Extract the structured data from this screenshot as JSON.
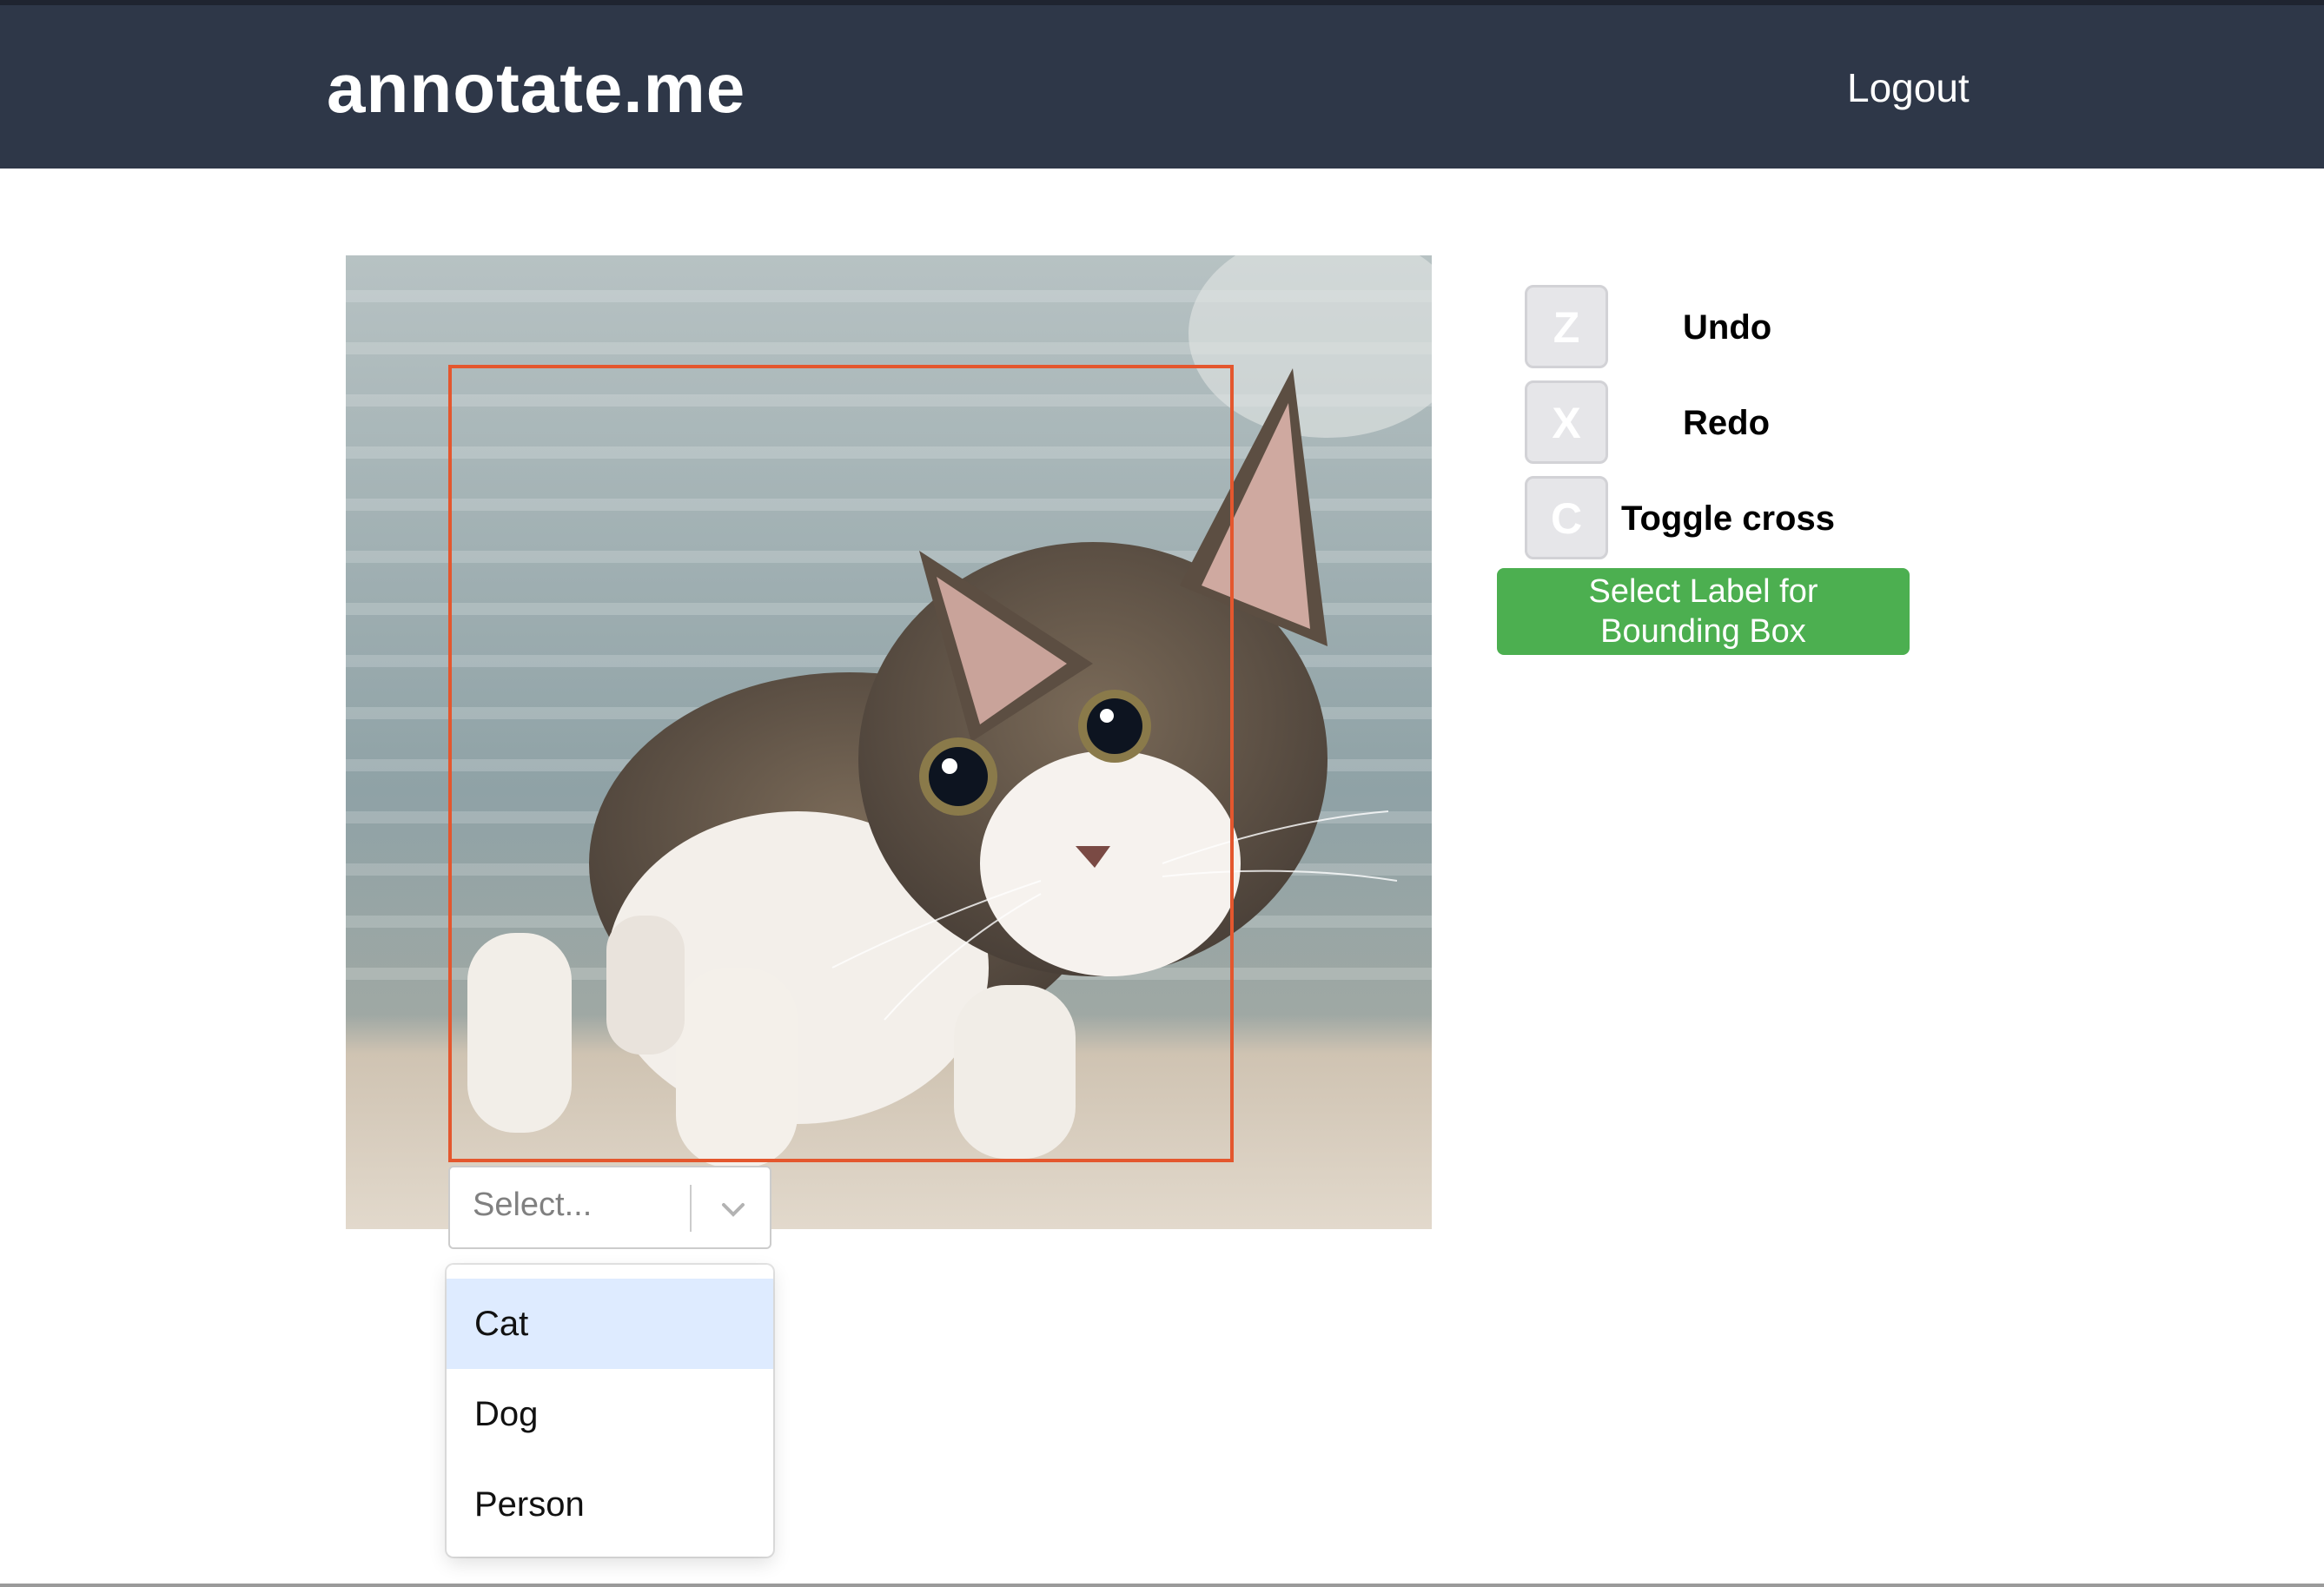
{
  "header": {
    "brand": "annotate.me",
    "logout_label": "Logout",
    "background": "#2e3748"
  },
  "canvas": {
    "image_subject": "tabby-and-white kitten photo",
    "bbox_color": "#e4572e"
  },
  "label_select": {
    "placeholder": "Select...",
    "options": [
      "Cat",
      "Dog",
      "Person"
    ],
    "highlighted_option": "Cat"
  },
  "shortcuts": [
    {
      "key": "Z",
      "action": "Undo"
    },
    {
      "key": "X",
      "action": "Redo"
    },
    {
      "key": "C",
      "action": "Toggle cross"
    }
  ],
  "label_button": {
    "line1": "Select Label for",
    "line2": "Bounding Box",
    "color": "#4caf50"
  }
}
